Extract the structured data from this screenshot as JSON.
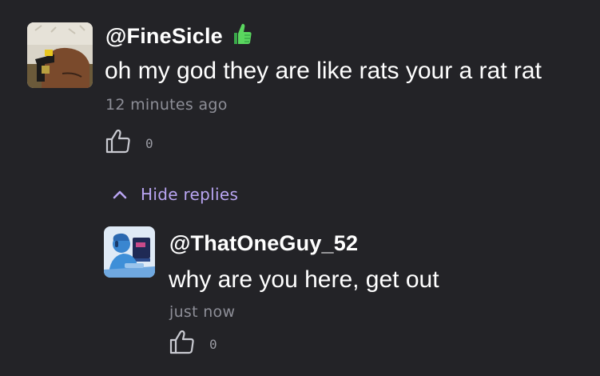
{
  "comments": [
    {
      "username": "@FineSicle",
      "badge_icon": "thumbs-up-emoji-icon",
      "text": "oh my god they are like rats your a rat rat",
      "timestamp": "12 minutes ago",
      "likes": "0"
    }
  ],
  "replies_toggle": {
    "label": "Hide replies",
    "icon": "chevron-up-icon"
  },
  "replies": [
    {
      "username": "@ThatOneGuy_52",
      "text": "why are you here, get out",
      "timestamp": "just now",
      "likes": "0"
    }
  ],
  "colors": {
    "background": "#232327",
    "text": "#ffffff",
    "muted": "#8d8e97",
    "accent": "#b9a5f2",
    "badge": "#4cd15a"
  }
}
